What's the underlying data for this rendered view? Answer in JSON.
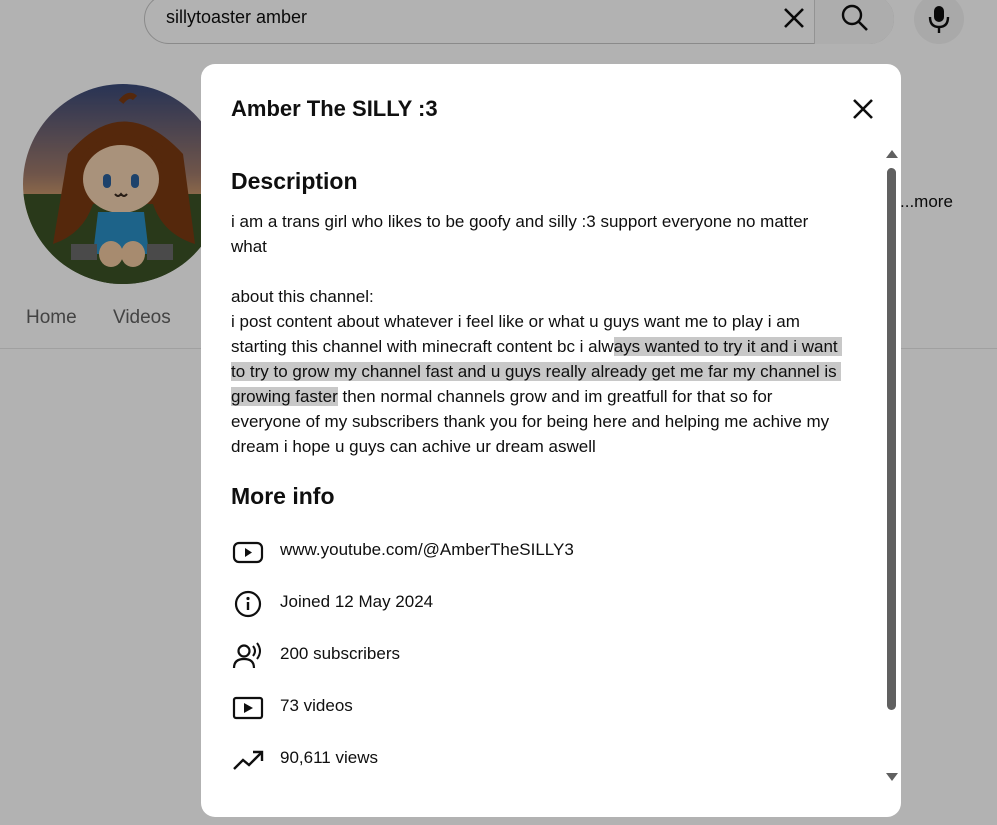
{
  "search": {
    "query": "sillytoaster amber"
  },
  "channel_page": {
    "more_label": "...more",
    "tabs": [
      {
        "label": "Home"
      },
      {
        "label": "Videos"
      }
    ]
  },
  "dialog": {
    "title": "Amber The SILLY :3",
    "description_heading": "Description",
    "description": {
      "part1": "i am a trans girl who likes to be goofy and silly :3 support everyone no matter what\n\nabout this channel:\ni post content about whatever i feel like or what u guys want me to play i am starting this channel with minecraft content bc i alw",
      "highlighted": "ays wanted to try it and i want to try to grow my channel fast and u guys really already get me far my channel is growing faster",
      "part2": " then normal channels grow and im greatfull for that so for everyone of my subscribers thank you for being here and helping me achive my dream i hope u guys can achive ur dream aswell"
    },
    "more_info_heading": "More info",
    "info": {
      "url": {
        "icon": "youtube-play-icon",
        "text": "www.youtube.com/@AmberTheSILLY3"
      },
      "joined": {
        "icon": "info-icon",
        "text": "Joined 12 May 2024"
      },
      "subscribers": {
        "icon": "subscribers-icon",
        "text": "200 subscribers"
      },
      "videos": {
        "icon": "video-icon",
        "text": "73 videos"
      },
      "views": {
        "icon": "trending-icon",
        "text": "90,611 views"
      }
    }
  },
  "colors": {
    "overlay": "rgba(0,0,0,0.30)",
    "highlight": "#c8c8c8",
    "scrollbar": "#606060"
  }
}
